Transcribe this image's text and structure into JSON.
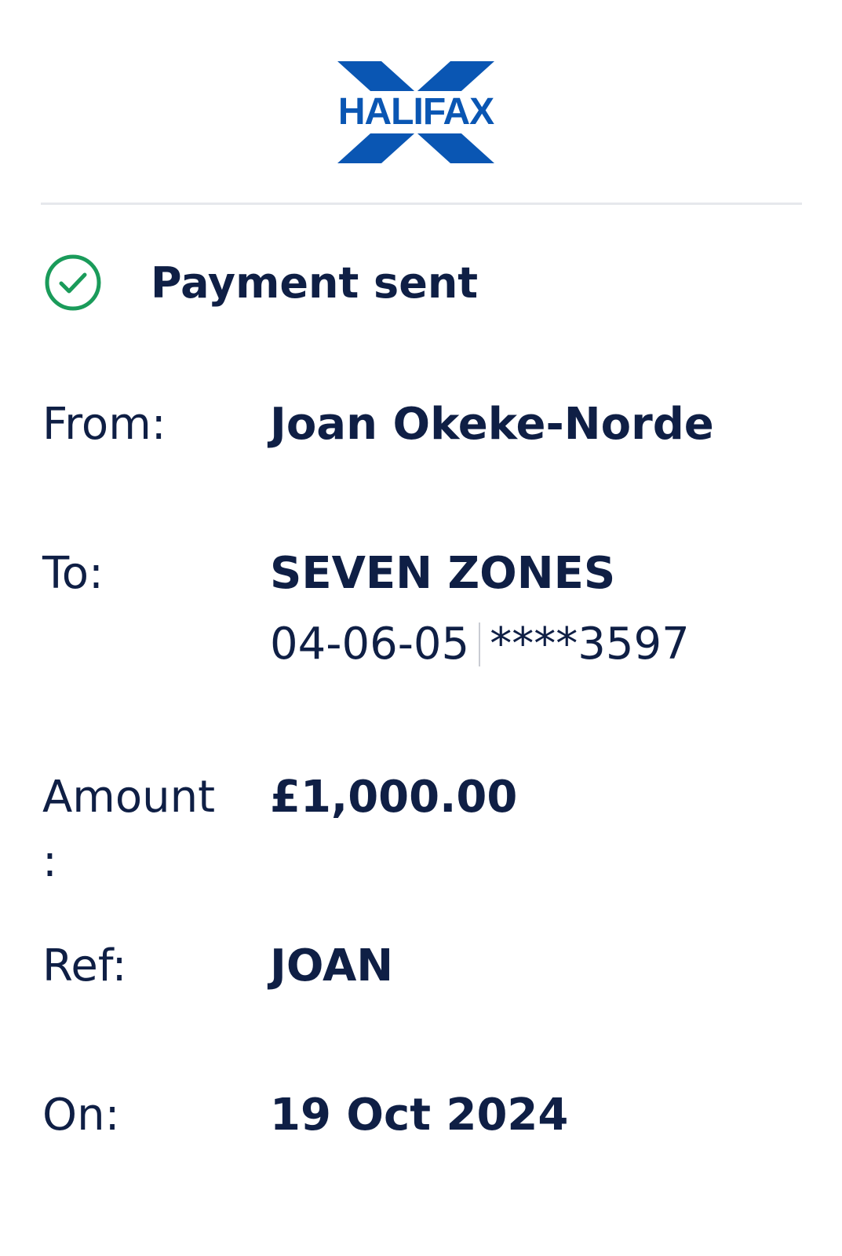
{
  "brand": {
    "name": "HALIFAX",
    "color": "#0a56b3"
  },
  "status": {
    "icon": "check-circle-icon",
    "title": "Payment sent",
    "icon_color": "#1a9b5a"
  },
  "details": {
    "from_label": "From:",
    "from_value": "Joan Okeke-Norde",
    "to_label": "To:",
    "to_value": "SEVEN ZONES",
    "sort_code": "04-06-05",
    "account_number": "****3597",
    "amount_label": "Amount\n:",
    "amount_value": "£1,000.00",
    "ref_label": "Ref:",
    "ref_value": "JOAN",
    "on_label": "On:",
    "on_value": "19 Oct 2024"
  },
  "colors": {
    "text": "#0f1f45",
    "divider": "#e6e8ec"
  }
}
